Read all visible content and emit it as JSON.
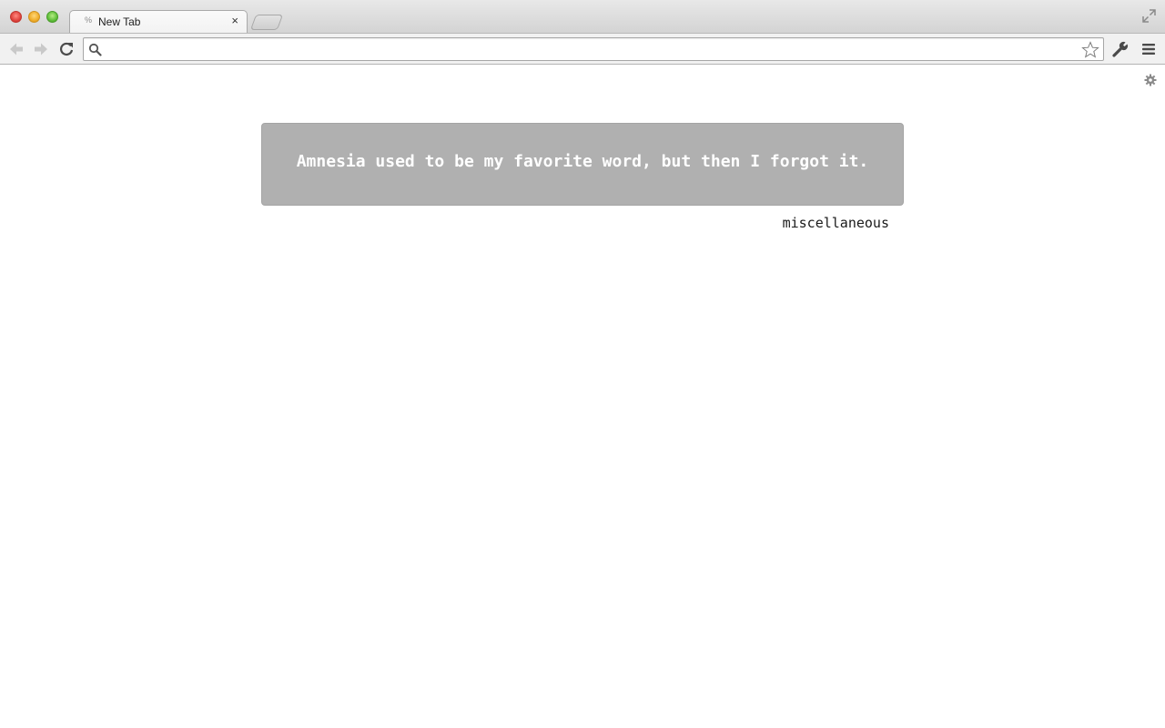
{
  "browser": {
    "tab": {
      "title": "New Tab",
      "favicon": "new-tab-favicon",
      "close_glyph": "×"
    },
    "omnibox": {
      "value": "",
      "placeholder": ""
    },
    "icons": [
      "back-arrow-icon",
      "forward-arrow-icon",
      "reload-icon",
      "search-icon",
      "star-icon",
      "wrench-icon",
      "hamburger-menu-icon",
      "fullscreen-icon",
      "gear-icon"
    ]
  },
  "page": {
    "quote": "Amnesia used to be my favorite word, but then I forgot it.",
    "category": "miscellaneous",
    "quote_box_color": "#b0b0b0"
  }
}
